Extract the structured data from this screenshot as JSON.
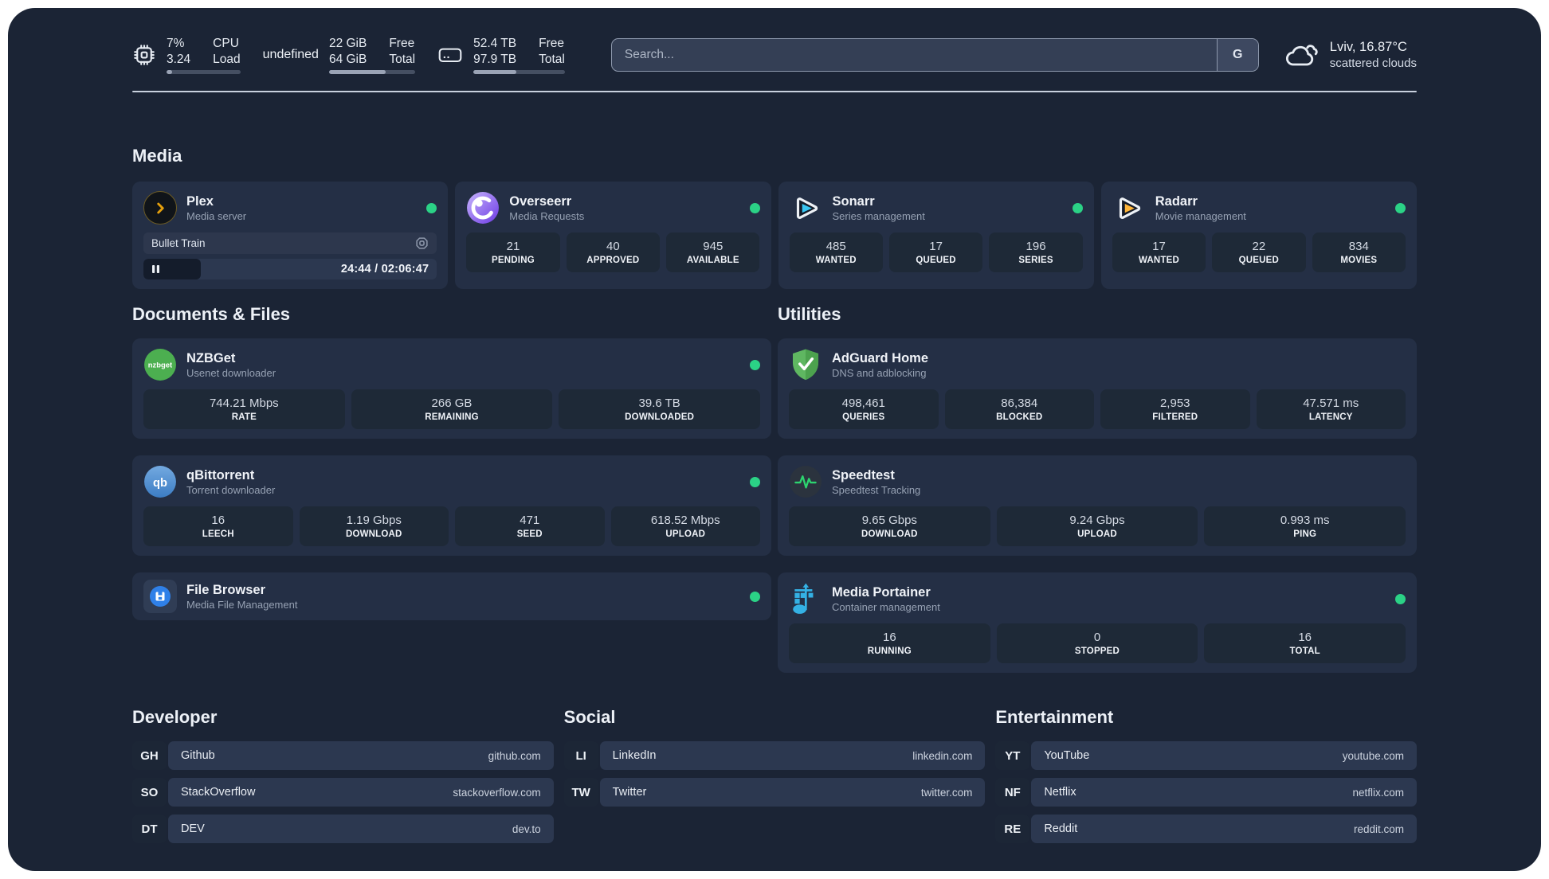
{
  "topbar": {
    "stats": [
      {
        "id": "cpu",
        "icon": "cpu-icon",
        "col1": [
          "7%",
          "3.24"
        ],
        "col2": [
          "CPU",
          "Load"
        ],
        "progress_pct": 8
      },
      {
        "id": "memory",
        "icon": "ram-icon",
        "col1": [
          "22 GiB",
          "64 GiB"
        ],
        "col2": [
          "Free",
          "Total"
        ],
        "progress_pct": 66
      },
      {
        "id": "disk",
        "icon": "disk-icon",
        "col1": [
          "52.4 TB",
          "97.9 TB"
        ],
        "col2": [
          "Free",
          "Total"
        ],
        "progress_pct": 47
      }
    ],
    "search_placeholder": "Search...",
    "search_button": "G",
    "weather": {
      "title": "Lviv, 16.87°C",
      "subtitle": "scattered clouds"
    }
  },
  "media": {
    "title": "Media",
    "cards": [
      {
        "name": "Plex",
        "desc": "Media server",
        "icon": "plex",
        "online": true,
        "now_playing": {
          "title": "Bullet Train",
          "time_display": "24:44 / 02:06:47",
          "progress_pct": 19.5
        }
      },
      {
        "name": "Overseerr",
        "desc": "Media Requests",
        "icon": "overseerr",
        "online": true,
        "stats": [
          {
            "value": "21",
            "label": "PENDING"
          },
          {
            "value": "40",
            "label": "APPROVED"
          },
          {
            "value": "945",
            "label": "AVAILABLE"
          }
        ]
      },
      {
        "name": "Sonarr",
        "desc": "Series management",
        "icon": "sonarr",
        "online": true,
        "stats": [
          {
            "value": "485",
            "label": "WANTED"
          },
          {
            "value": "17",
            "label": "QUEUED"
          },
          {
            "value": "196",
            "label": "SERIES"
          }
        ]
      },
      {
        "name": "Radarr",
        "desc": "Movie management",
        "icon": "radarr",
        "online": true,
        "stats": [
          {
            "value": "17",
            "label": "WANTED"
          },
          {
            "value": "22",
            "label": "QUEUED"
          },
          {
            "value": "834",
            "label": "MOVIES"
          }
        ]
      }
    ]
  },
  "columns": [
    {
      "title": "Documents & Files",
      "cards": [
        {
          "name": "NZBGet",
          "desc": "Usenet downloader",
          "icon": "nzbget",
          "online": true,
          "stats": [
            {
              "value": "744.21 Mbps",
              "label": "RATE"
            },
            {
              "value": "266 GB",
              "label": "REMAINING"
            },
            {
              "value": "39.6 TB",
              "label": "DOWNLOADED"
            }
          ]
        },
        {
          "name": "qBittorrent",
          "desc": "Torrent downloader",
          "icon": "qbittorrent",
          "online": true,
          "stats": [
            {
              "value": "16",
              "label": "LEECH"
            },
            {
              "value": "1.19 Gbps",
              "label": "DOWNLOAD"
            },
            {
              "value": "471",
              "label": "SEED"
            },
            {
              "value": "618.52 Mbps",
              "label": "UPLOAD"
            }
          ]
        },
        {
          "name": "File Browser",
          "desc": "Media File Management",
          "icon": "filebrowser",
          "online": true,
          "stats": []
        }
      ]
    },
    {
      "title": "Utilities",
      "cards": [
        {
          "name": "AdGuard Home",
          "desc": "DNS and adblocking",
          "icon": "adguard",
          "online": false,
          "stats": [
            {
              "value": "498,461",
              "label": "QUERIES"
            },
            {
              "value": "86,384",
              "label": "BLOCKED"
            },
            {
              "value": "2,953",
              "label": "FILTERED"
            },
            {
              "value": "47.571 ms",
              "label": "LATENCY"
            }
          ]
        },
        {
          "name": "Speedtest",
          "desc": "Speedtest Tracking",
          "icon": "speedtest",
          "online": false,
          "stats": [
            {
              "value": "9.65 Gbps",
              "label": "DOWNLOAD"
            },
            {
              "value": "9.24 Gbps",
              "label": "UPLOAD"
            },
            {
              "value": "0.993 ms",
              "label": "PING"
            }
          ]
        },
        {
          "name": "Media Portainer",
          "desc": "Container management",
          "icon": "portainer",
          "online": true,
          "stats": [
            {
              "value": "16",
              "label": "RUNNING"
            },
            {
              "value": "0",
              "label": "STOPPED"
            },
            {
              "value": "16",
              "label": "TOTAL"
            }
          ]
        }
      ]
    }
  ],
  "bookmark_groups": [
    {
      "title": "Developer",
      "links": [
        {
          "abbr": "GH",
          "name": "Github",
          "url": "github.com"
        },
        {
          "abbr": "SO",
          "name": "StackOverflow",
          "url": "stackoverflow.com"
        },
        {
          "abbr": "DT",
          "name": "DEV",
          "url": "dev.to"
        }
      ]
    },
    {
      "title": "Social",
      "links": [
        {
          "abbr": "LI",
          "name": "LinkedIn",
          "url": "linkedin.com"
        },
        {
          "abbr": "TW",
          "name": "Twitter",
          "url": "twitter.com"
        }
      ]
    },
    {
      "title": "Entertainment",
      "links": [
        {
          "abbr": "YT",
          "name": "YouTube",
          "url": "youtube.com"
        },
        {
          "abbr": "NF",
          "name": "Netflix",
          "url": "netflix.com"
        },
        {
          "abbr": "RE",
          "name": "Reddit",
          "url": "reddit.com"
        }
      ]
    }
  ],
  "colors": {
    "background": "#1b2435",
    "card": "#242f45",
    "tile": "#1e2937",
    "status_online": "#2bd286",
    "accent_plex": "#e5a00d",
    "accent_sonarr": "#38c5f1",
    "accent_radarr": "#ffb53a",
    "divider": "#c9d1de"
  }
}
